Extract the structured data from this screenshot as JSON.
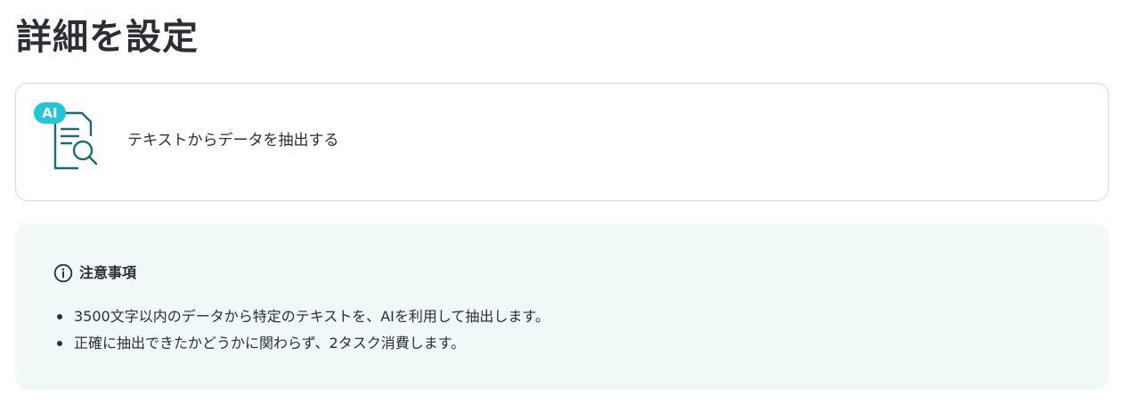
{
  "page": {
    "title": "詳細を設定"
  },
  "action": {
    "badge": "AI",
    "icon": "document-search-icon",
    "label": "テキストからデータを抽出する"
  },
  "notice": {
    "icon": "info-icon",
    "title": "注意事項",
    "items": [
      "3500文字以内のデータから特定のテキストを、AIを利用して抽出します。",
      "正確に抽出できたかどうかに関わらず、2タスク消費します。"
    ]
  },
  "colors": {
    "accent": "#22c6d9",
    "icon_stroke": "#1a6b78",
    "notice_bg": "#f1f8f8",
    "card_border": "#d4d8dc",
    "text": "#2b2f33"
  }
}
